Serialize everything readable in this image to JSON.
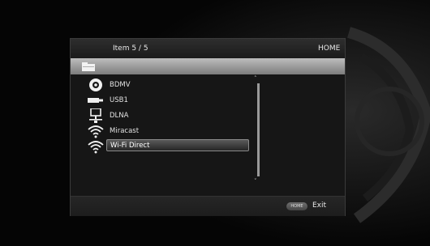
{
  "header": {
    "item_count": "Item 5 / 5",
    "title": "HOME"
  },
  "menu": {
    "items": [
      {
        "label": "BDMV",
        "icon": "disc-icon"
      },
      {
        "label": "USB1",
        "icon": "usb-drive-icon"
      },
      {
        "label": "DLNA",
        "icon": "network-server-icon"
      },
      {
        "label": "Miracast",
        "icon": "wifi-icon"
      },
      {
        "label": "Wi-Fi Direct",
        "icon": "wifi-icon",
        "selected": true
      }
    ]
  },
  "scrollbar": {
    "position_fraction": 1.0
  },
  "footer": {
    "home_button": "HOME",
    "exit_label": "Exit"
  },
  "colors": {
    "panel": "#161616",
    "path_bar": "#a5a5a5",
    "selection": "#4a4a4a"
  }
}
